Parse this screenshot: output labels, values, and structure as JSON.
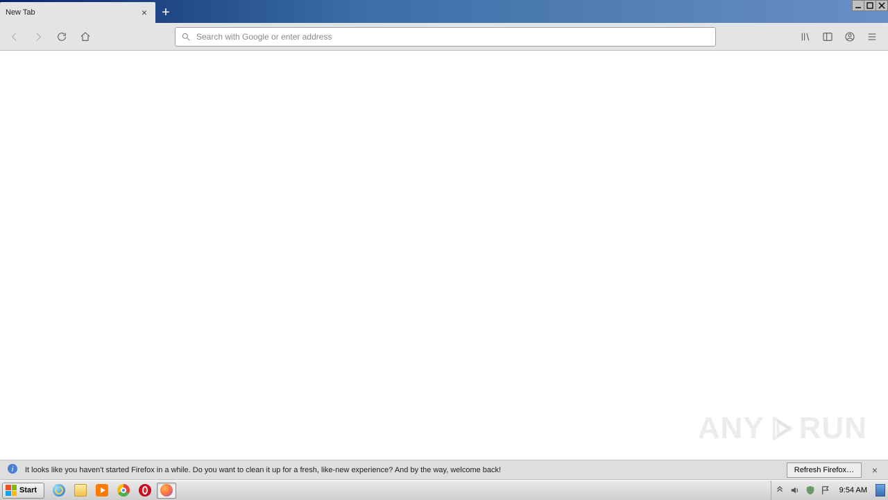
{
  "tab": {
    "title": "New Tab"
  },
  "addressbar": {
    "placeholder": "Search with Google or enter address",
    "value": ""
  },
  "infobar": {
    "message": "It looks like you haven't started Firefox in a while. Do you want to clean it up for a fresh, like-new experience? And by the way, welcome back!",
    "button": "Refresh Firefox…"
  },
  "taskbar": {
    "start": "Start",
    "clock": "9:54 AM"
  },
  "watermark": {
    "left": "ANY",
    "right": "RUN"
  }
}
